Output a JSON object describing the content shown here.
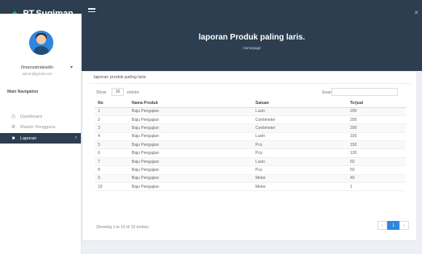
{
  "app": {
    "brand": "PT.Sugiman"
  },
  "sidebar": {
    "user_name": "Ilmansatriakadin",
    "user_email": "admin@gmail.com",
    "header": "Main Navigation",
    "items": [
      {
        "label": "Dashboard",
        "icon": "dashboard-icon",
        "active": false
      },
      {
        "label": "Master Pengguna",
        "icon": "users-icon",
        "active": false
      },
      {
        "label": "Laporan",
        "icon": "report-icon",
        "active": true
      }
    ]
  },
  "banner": {
    "title": "laporan Produk paling laris.",
    "subtitle": "Homepage"
  },
  "card": {
    "title": "laporan produk paling laris"
  },
  "controls": {
    "show_label": "Show",
    "show_value": "10",
    "entries_label": "entries",
    "search_label": "Search:",
    "search_value": ""
  },
  "table": {
    "headers": [
      "No",
      "Nama Produk",
      "Satuan",
      "Terjual"
    ],
    "rows": [
      [
        "1",
        "Baju Pengajian",
        "Lusin",
        "200"
      ],
      [
        "2",
        "Baju Pengajian",
        "Centimeter",
        "200"
      ],
      [
        "3",
        "Baju Pengajian",
        "Centimeter",
        "200"
      ],
      [
        "4",
        "Baju Pengajian",
        "Lusin",
        "150"
      ],
      [
        "5",
        "Baju Pengajian",
        "Pcs",
        "150"
      ],
      [
        "6",
        "Baju Pengajian",
        "Pcs",
        "120"
      ],
      [
        "7",
        "Baju Pengajian",
        "Lusin",
        "60"
      ],
      [
        "8",
        "Baju Pengajian",
        "Pcs",
        "50"
      ],
      [
        "9",
        "Baju Pengajian",
        "Meter",
        "40"
      ],
      [
        "10",
        "Baju Pengajian",
        "Meter",
        "1"
      ]
    ]
  },
  "footer": {
    "info": "Showing 1 to 10 of 10 entries",
    "prev": "‹",
    "page": "1",
    "next": "›"
  },
  "colors": {
    "primary": "#2c3e50",
    "accent": "#2e86de",
    "brand_leaf": "#27ae60"
  }
}
